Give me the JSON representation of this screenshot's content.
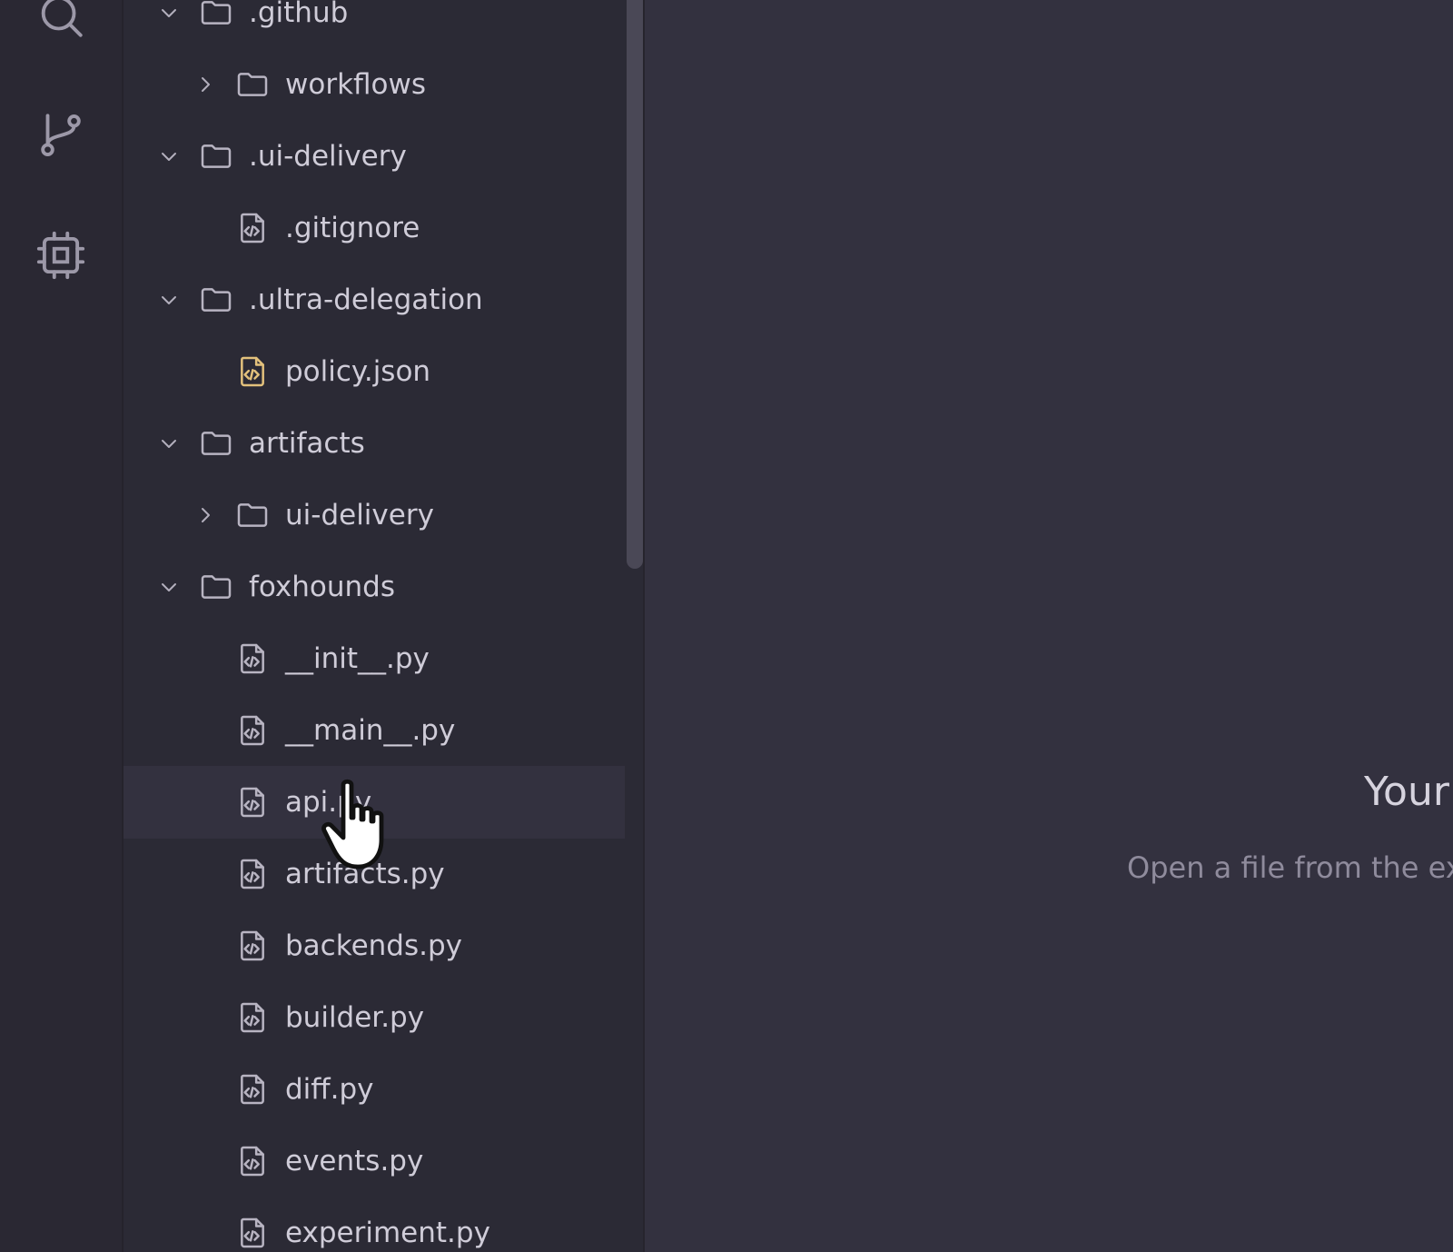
{
  "explorer": {
    "items": [
      {
        "name": ".github",
        "kind": "folder",
        "expanded": true,
        "depth": 0
      },
      {
        "name": "workflows",
        "kind": "folder",
        "expanded": false,
        "depth": 1
      },
      {
        "name": ".ui-delivery",
        "kind": "folder",
        "expanded": true,
        "depth": 0
      },
      {
        "name": ".gitignore",
        "kind": "file",
        "depth": 1
      },
      {
        "name": ".ultra-delegation",
        "kind": "folder",
        "expanded": true,
        "depth": 0
      },
      {
        "name": "policy.json",
        "kind": "json",
        "depth": 1
      },
      {
        "name": "artifacts",
        "kind": "folder",
        "expanded": true,
        "depth": 0
      },
      {
        "name": "ui-delivery",
        "kind": "folder",
        "expanded": false,
        "depth": 1
      },
      {
        "name": "foxhounds",
        "kind": "folder",
        "expanded": true,
        "depth": 0
      },
      {
        "name": "__init__.py",
        "kind": "file",
        "depth": 1
      },
      {
        "name": "__main__.py",
        "kind": "file",
        "depth": 1
      },
      {
        "name": "api.py",
        "kind": "file",
        "depth": 1,
        "hovered": true
      },
      {
        "name": "artifacts.py",
        "kind": "file",
        "depth": 1
      },
      {
        "name": "backends.py",
        "kind": "file",
        "depth": 1
      },
      {
        "name": "builder.py",
        "kind": "file",
        "depth": 1
      },
      {
        "name": "diff.py",
        "kind": "file",
        "depth": 1
      },
      {
        "name": "events.py",
        "kind": "file",
        "depth": 1
      },
      {
        "name": "experiment.py",
        "kind": "file",
        "depth": 1
      }
    ]
  },
  "editor": {
    "empty_title": "Your",
    "empty_subtitle": "Open a file from the ex"
  },
  "colors": {
    "background": "#33313f",
    "sidebar": "#2b2a35",
    "json_icon": "#e3c17c"
  },
  "icons": {
    "activity": [
      "search-icon",
      "source-control-icon",
      "chip-icon"
    ],
    "cursor": "hand-pointer-icon"
  }
}
